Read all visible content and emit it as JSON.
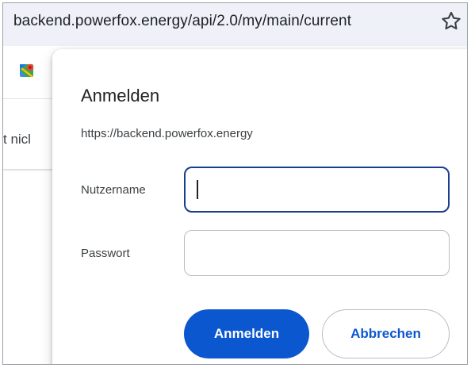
{
  "browser": {
    "url": "backend.powerfox.energy/api/2.0/my/main/current",
    "bookmark_icon": "star-icon"
  },
  "background_page": {
    "bookmark_icon": "maps-icon",
    "partial_text": "t nicl"
  },
  "auth_dialog": {
    "title": "Anmelden",
    "origin": "https://backend.powerfox.energy",
    "username_label": "Nutzername",
    "username_value": "",
    "password_label": "Passwort",
    "password_value": "",
    "submit_label": "Anmelden",
    "cancel_label": "Abbrechen"
  },
  "colors": {
    "accent": "#0b57d0",
    "focus_border": "#1a3d8f",
    "address_bar_bg": "#eef2f8"
  }
}
